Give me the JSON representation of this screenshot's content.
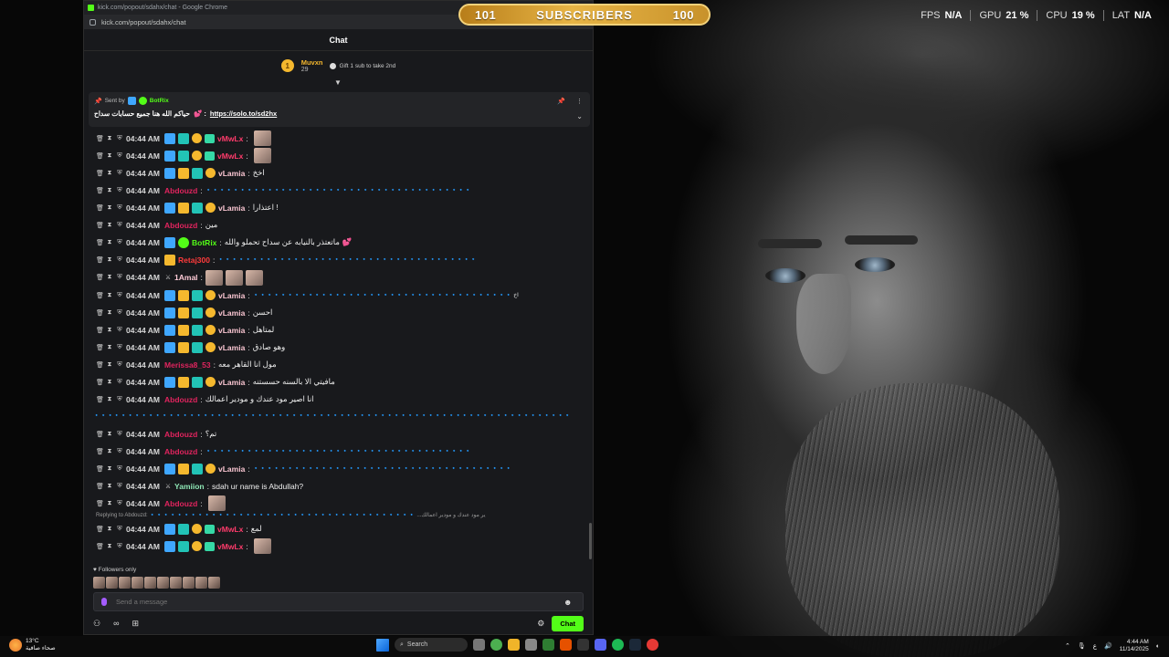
{
  "banner": {
    "left_num": "101",
    "label": "SUBSCRIBERS",
    "right_num": "100"
  },
  "stats": [
    {
      "label": "FPS",
      "value": "N/A"
    },
    {
      "label": "GPU",
      "value": "21 %"
    },
    {
      "label": "CPU",
      "value": "19 %"
    },
    {
      "label": "LAT",
      "value": "N/A"
    }
  ],
  "browser": {
    "title": "kick.com/popout/sdahx/chat - Google Chrome",
    "url": "kick.com/popout/sdahx/chat"
  },
  "chat": {
    "header": "Chat",
    "gifter": {
      "rank": "1",
      "name": "Muvxn",
      "count": "29",
      "gift_text": "Gift 1 sub to take 2nd"
    },
    "pinned": {
      "sent_by": "Sent by",
      "sender": "BotRix",
      "message": "حياكم الله هنا جميع حسابات سداح",
      "link": "https://solo.to/sd2hx"
    },
    "messages": [
      {
        "time": "04:44 AM",
        "user": "vMwLx",
        "text": ""
      },
      {
        "time": "04:44 AM",
        "user": "vMwLx",
        "text": ""
      },
      {
        "time": "04:44 AM",
        "user": "vLamia",
        "text": "اخخ"
      },
      {
        "time": "04:44 AM",
        "user": "Abdouzd",
        "text": "🔹🔹🔹🔹🔹🔹🔹🔹🔹🔹🔹🔹🔹🔹🔹🔹🔹🔹🔹🔹🔹🔹🔹🔹🔹🔹🔹🔹🔹🔹🔹🔹🔹🔹🔹🔹🔹🔹🔹"
      },
      {
        "time": "04:44 AM",
        "user": "vLamia",
        "text": "اعتذارا !"
      },
      {
        "time": "04:44 AM",
        "user": "Abdouzd",
        "text": "مين"
      },
      {
        "time": "04:44 AM",
        "user": "BotRix",
        "text": "ماتعتذر بالنيابه عن سداح تحملو والله"
      },
      {
        "time": "04:44 AM",
        "user": "Retaj300",
        "text": "🔹🔹🔹🔹🔹🔹🔹🔹🔹🔹🔹🔹🔹🔹🔹🔹🔹🔹🔹🔹🔹🔹🔹🔹🔹🔹🔹🔹🔹🔹🔹🔹🔹🔹🔹🔹🔹🔹"
      },
      {
        "time": "04:44 AM",
        "user": "1Amal",
        "text": ""
      },
      {
        "time": "04:44 AM",
        "user": "vLamia",
        "text": "🔹🔹🔹🔹🔹🔹🔹🔹🔹🔹🔹🔹🔹🔹🔹🔹🔹🔹🔹🔹🔹🔹🔹🔹🔹🔹🔹🔹🔹🔹🔹🔹🔹🔹🔹🔹🔹🔹 اخ"
      },
      {
        "time": "04:44 AM",
        "user": "vLamia",
        "text": "احسن"
      },
      {
        "time": "04:44 AM",
        "user": "vLamia",
        "text": "لمتاهل"
      },
      {
        "time": "04:44 AM",
        "user": "vLamia",
        "text": "وهو صادق"
      },
      {
        "time": "04:44 AM",
        "user": "Merissa8_53",
        "text": "مول انا القاهر معه"
      },
      {
        "time": "04:44 AM",
        "user": "vLamia",
        "text": "مافيتي الا بالسنه حسستنه"
      },
      {
        "time": "04:44 AM",
        "user": "Abdouzd",
        "text": "انا اصير مود عندك و مودير اعمالك"
      },
      {
        "time": "04:44 AM",
        "user": "Abdouzd",
        "text": "تم؟"
      },
      {
        "time": "04:44 AM",
        "user": "Abdouzd",
        "text": "🔹🔹🔹🔹🔹🔹🔹🔹🔹🔹🔹🔹🔹🔹🔹🔹🔹🔹🔹🔹🔹🔹🔹🔹🔹🔹🔹🔹🔹🔹🔹🔹🔹🔹🔹🔹🔹🔹🔹"
      },
      {
        "time": "04:44 AM",
        "user": "vLamia",
        "text": "🔹🔹🔹🔹🔹🔹🔹🔹🔹🔹🔹🔹🔹🔹🔹🔹🔹🔹🔹🔹🔹🔹🔹🔹🔹🔹🔹🔹🔹🔹🔹🔹🔹🔹🔹🔹🔹🔹"
      },
      {
        "time": "04:44 AM",
        "user": "Yamiion",
        "text": "sdah ur name is Abdullah?"
      },
      {
        "time": "04:44 AM",
        "user": "Abdouzd",
        "text": ""
      },
      {
        "time": "04:44 AM",
        "user": "vMwLx",
        "text": "لمع"
      },
      {
        "time": "04:44 AM",
        "user": "vMwLx",
        "text": ""
      }
    ],
    "wrapped_line": "🔹🔹🔹🔹🔹🔹🔹🔹🔹🔹🔹🔹🔹🔹🔹🔹🔹🔹🔹🔹🔹🔹🔹🔹🔹🔹🔹🔹🔹🔹🔹🔹🔹🔹🔹🔹🔹🔹🔹🔹🔹🔹🔹🔹🔹🔹🔹🔹🔹🔹🔹🔹🔹🔹🔹🔹🔹🔹🔹🔹🔹🔹🔹🔹🔹🔹🔹🔹🔹🔹",
    "reply_preview": "Replying to Abdouzd: 🔹🔹🔹🔹🔹🔹🔹🔹🔹🔹🔹🔹🔹🔹🔹🔹🔹🔹🔹🔹🔹🔹🔹🔹🔹🔹🔹🔹🔹🔹🔹🔹🔹🔹🔹🔹🔹🔹🔹 ...ير مود عندك و مودير اعمالك",
    "followers_only": "Followers only",
    "input_placeholder": "Send a message",
    "chat_button": "Chat",
    "infinity": "∞"
  },
  "taskbar": {
    "weather_temp": "13°C",
    "weather_desc": "صحاء صافية",
    "search": "Search",
    "time": "4:44 AM",
    "date": "11/14/2025",
    "lang": "ع"
  }
}
